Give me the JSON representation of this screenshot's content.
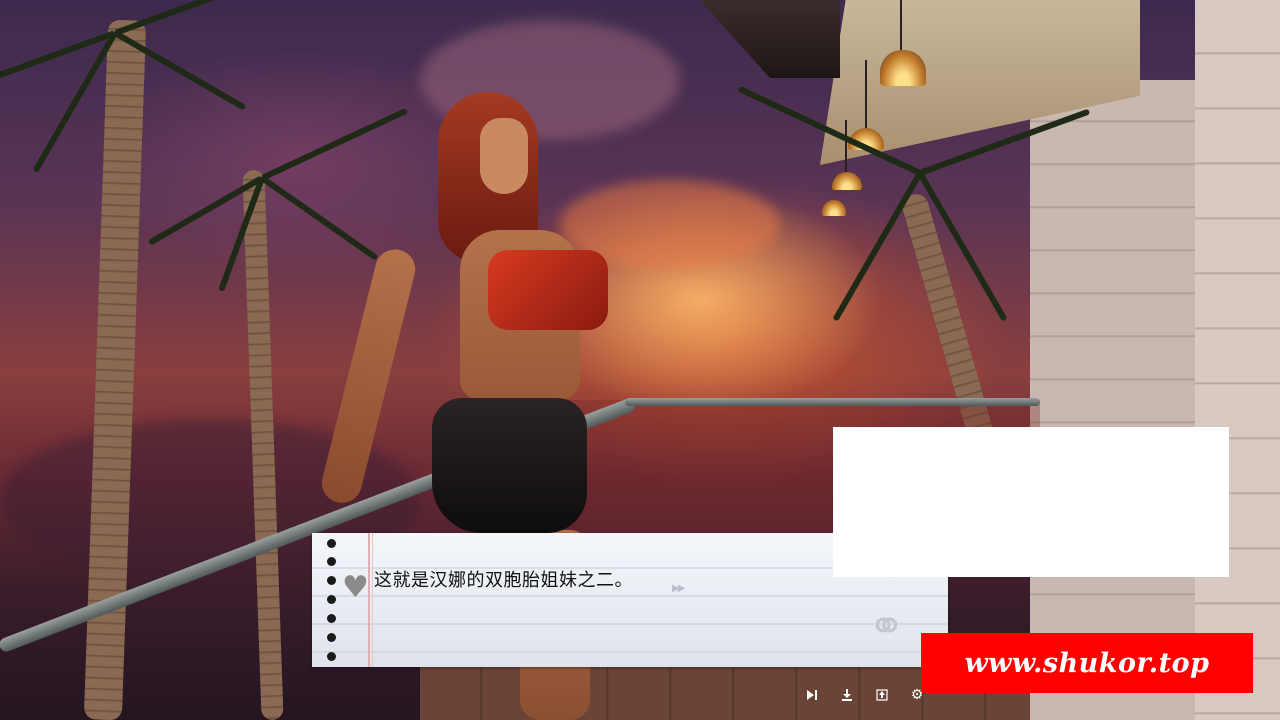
{
  "dialogue": {
    "text": "这就是汉娜的双胞胎姐妹之二。"
  },
  "watermark": {
    "text": "www.shukor.top"
  },
  "quick_menu": {
    "skip": "skip-icon",
    "save": "download-icon",
    "load": "upload-icon",
    "settings": "gear-icon"
  },
  "colors": {
    "textbox_bg": "#f4f6fa",
    "watermark_bg": "#ff0000",
    "dialogue_text": "#111111"
  }
}
